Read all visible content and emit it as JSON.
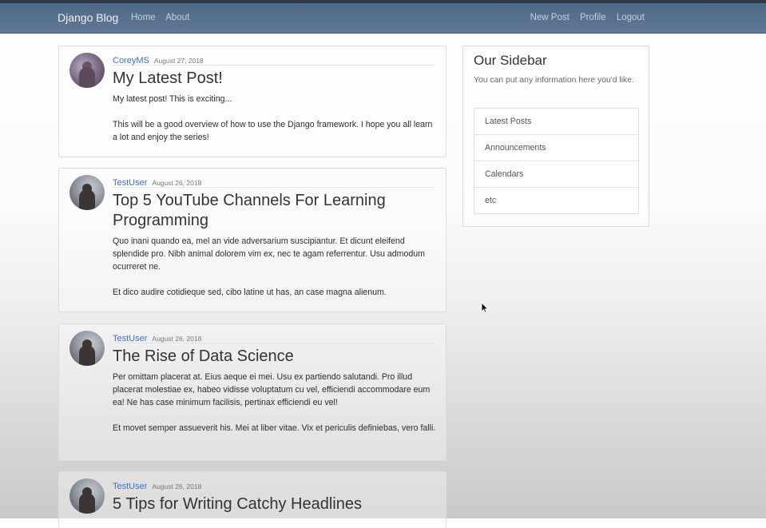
{
  "navbar": {
    "brand": "Django Blog",
    "left_links": [
      "Home",
      "About"
    ],
    "right_links": [
      "New Post",
      "Profile",
      "Logout"
    ]
  },
  "posts": [
    {
      "author": "CoreyMS",
      "date": "August 27, 2018",
      "title": "My Latest Post!",
      "paragraphs": [
        "My latest post! This is exciting...",
        "This will be a good overview of how to use the Django framework. I hope you all learn a lot and enjoy the series!"
      ]
    },
    {
      "author": "TestUser",
      "date": "August 26, 2018",
      "title": "Top 5 YouTube Channels For Learning Programming",
      "paragraphs": [
        "Quo inani quando ea, mel an vide adversarium suscipiantur. Et dicunt eleifend splendide pro. Nibh animal dolorem vim ex, nec te agam referrentur. Usu admodum ocurreret ne.",
        "Et dico audire cotidieque sed, cibo latine ut has, an case magna alienum."
      ]
    },
    {
      "author": "TestUser",
      "date": "August 26, 2018",
      "title": "The Rise of Data Science",
      "paragraphs": [
        "Per omittam placerat at. Eius aeque ei mei. Usu ex partiendo salutandi. Pro illud placerat molestiae ex, habeo vidisse voluptatum cu vel, efficiendi accommodare eum ea! Ne has case minimum facilisis, pertinax efficiendi eu vel!",
        "Et movet semper assueverit his. Mei at liber vitae. Vix et periculis definiebas, vero falli."
      ]
    },
    {
      "author": "TestUser",
      "date": "August 26, 2018",
      "title": "5 Tips for Writing Catchy Headlines",
      "paragraphs": []
    }
  ],
  "sidebar": {
    "title": "Our Sidebar",
    "description": "You can put any information here you'd like.",
    "items": [
      "Latest Posts",
      "Announcements",
      "Calendars",
      "etc"
    ]
  }
}
